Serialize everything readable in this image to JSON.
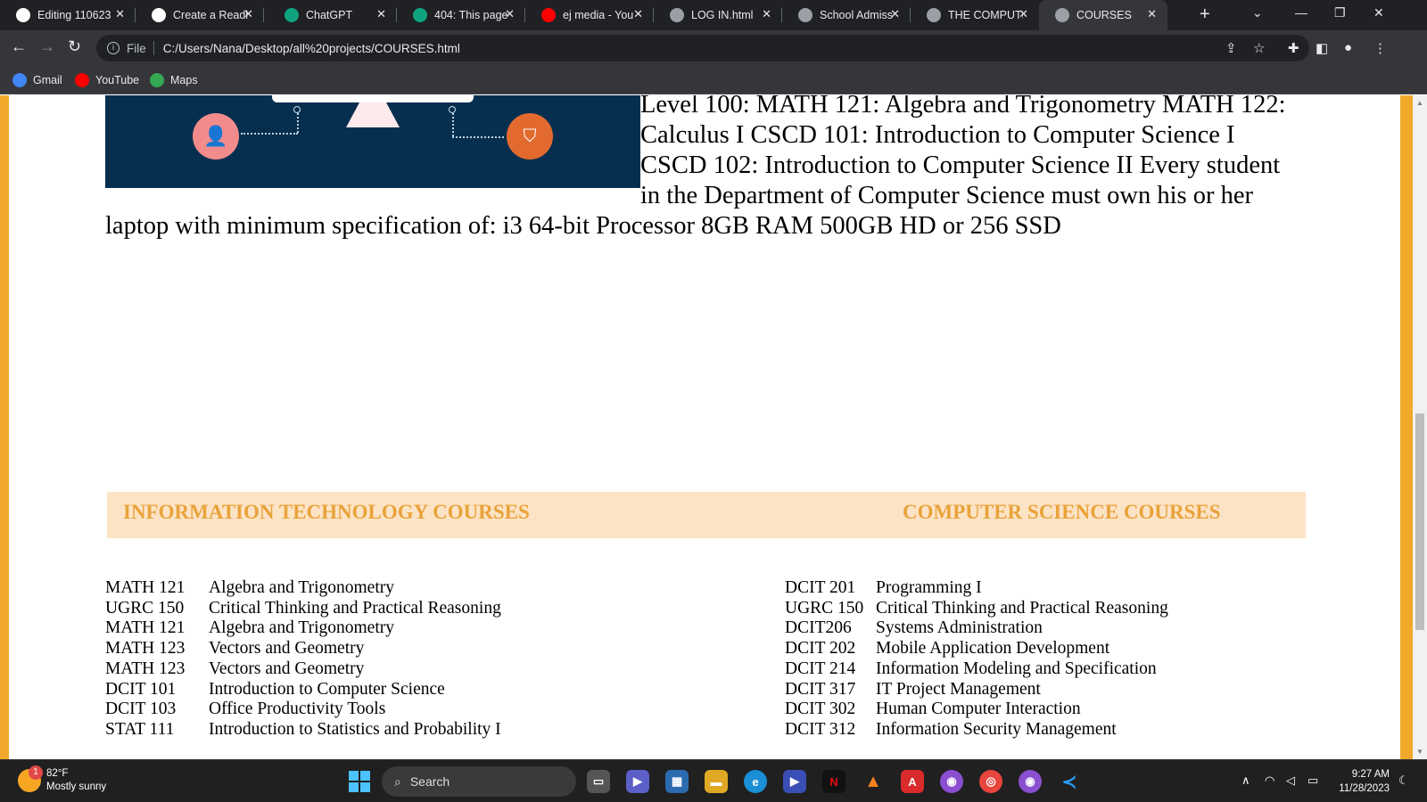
{
  "browser": {
    "tabs": [
      {
        "title": "Editing 110623",
        "icon": "github-icon",
        "color": "#ffffff"
      },
      {
        "title": "Create a Readl",
        "icon": "readme-icon",
        "color": "#ffffff"
      },
      {
        "title": "ChatGPT",
        "icon": "chatgpt-icon",
        "color": "#10a37f"
      },
      {
        "title": "404: This page",
        "icon": "chatgpt-icon",
        "color": "#10a37f"
      },
      {
        "title": "ej media - You",
        "icon": "youtube-icon",
        "color": "#ff0000"
      },
      {
        "title": "LOG IN.html",
        "icon": "globe-icon",
        "color": "#9aa0a6"
      },
      {
        "title": "School Admiss",
        "icon": "globe-icon",
        "color": "#9aa0a6"
      },
      {
        "title": "THE COMPUTE",
        "icon": "globe-icon",
        "color": "#9aa0a6"
      },
      {
        "title": "COURSES",
        "icon": "globe-icon",
        "color": "#9aa0a6",
        "active": true
      }
    ],
    "address": {
      "scheme_label": "File",
      "url": "C:/Users/Nana/Desktop/all%20projects/COURSES.html"
    },
    "bookmarks": [
      {
        "label": "Gmail",
        "icon": "google-icon",
        "color": "#4285f4"
      },
      {
        "label": "YouTube",
        "icon": "youtube-icon",
        "color": "#ff0000"
      },
      {
        "label": "Maps",
        "icon": "maps-icon",
        "color": "#34a853"
      }
    ]
  },
  "page": {
    "intro_text": "Level 100: MATH 121: Algebra and Trigonometry MATH 122: Calculus I CSCD 101: Introduction to Computer Science I CSCD 102: Introduction to Computer Science II Every student in the Department of Computer Science must own his or her laptop with minimum specification of: i3 64-bit Processor 8GB RAM 500GB HD or 256 SSD",
    "it_heading": "INFORMATION TECHNOLOGY COURSES",
    "cs_heading": "COMPUTER SCIENCE COURSES",
    "it_courses": [
      {
        "code": "MATH 121",
        "name": "Algebra and Trigonometry"
      },
      {
        "code": "UGRC 150",
        "name": "Critical Thinking and Practical Reasoning"
      },
      {
        "code": "MATH 121",
        "name": "Algebra and Trigonometry"
      },
      {
        "code": "MATH 123",
        "name": "Vectors and Geometry"
      },
      {
        "code": "MATH 123",
        "name": "Vectors and Geometry"
      },
      {
        "code": "DCIT 101",
        "name": "Introduction to Computer Science"
      },
      {
        "code": "DCIT 103",
        "name": "Office Productivity Tools"
      },
      {
        "code": "STAT 111",
        "name": "Introduction to Statistics and Probability I"
      }
    ],
    "cs_courses": [
      {
        "code": "DCIT 201",
        "name": "Programming I"
      },
      {
        "code": "UGRC 150",
        "name": "Critical Thinking and Practical Reasoning"
      },
      {
        "code": "DCIT206",
        "name": "Systems Administration"
      },
      {
        "code": "DCIT 202",
        "name": "Mobile Application Development"
      },
      {
        "code": "DCIT 214",
        "name": "Information Modeling and Specification"
      },
      {
        "code": "DCIT 317",
        "name": "IT Project Management"
      },
      {
        "code": "DCIT 302",
        "name": "Human Computer Interaction"
      },
      {
        "code": "DCIT 312",
        "name": "Information Security Management"
      }
    ]
  },
  "taskbar": {
    "weather": {
      "temp": "82°F",
      "desc": "Mostly sunny",
      "badge": "1"
    },
    "search_placeholder": "Search",
    "clock": {
      "time": "9:27 AM",
      "date": "11/28/2023"
    }
  },
  "colors": {
    "frame": "#f0a92a",
    "heading_bg": "#fde3c5",
    "heading_text": "#e8a33a",
    "hero_bg": "#062f4f"
  }
}
